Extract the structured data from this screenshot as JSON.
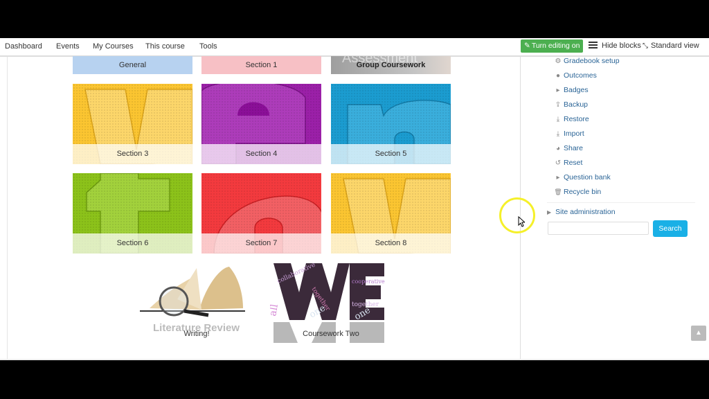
{
  "navbar": {
    "items": [
      "Dashboard",
      "Events",
      "My Courses",
      "This course",
      "Tools"
    ],
    "edit_button": "Turn editing on",
    "hide_blocks": "Hide blocks",
    "standard_view": "Standard view"
  },
  "sections": {
    "top_row": [
      {
        "label": "General",
        "color": "#a9c8ec",
        "caption_bg": "#b7d2f0"
      },
      {
        "label": "Section 1",
        "color": "#f7b7bd",
        "caption_bg": "#f7c0c5"
      },
      {
        "label": "Group Coursework",
        "color": "#b9b9b9",
        "caption_bg": "#c2c2c2",
        "overlay_text": "Assessment"
      }
    ],
    "tiles": [
      {
        "label": "Section 3",
        "color": "#fbc531",
        "letter": "v",
        "caption_bg": "rgba(255,255,255,0.72)"
      },
      {
        "label": "Section 4",
        "color": "#9b20a8",
        "letter": "e",
        "caption_bg": "rgba(255,255,255,0.72)"
      },
      {
        "label": "Section 5",
        "color": "#1b9cd0",
        "letter": "n",
        "caption_bg": "rgba(255,255,255,0.72)"
      },
      {
        "label": "Section 6",
        "color": "#8cc21a",
        "letter": "t",
        "caption_bg": "rgba(255,255,255,0.72)"
      },
      {
        "label": "Section 7",
        "color": "#f33a3e",
        "letter": "o",
        "caption_bg": "rgba(255,255,255,0.72)"
      },
      {
        "label": "Section 8",
        "color": "#fbc531",
        "letter": "v",
        "caption_bg": "rgba(255,255,255,0.72)"
      }
    ],
    "bottom_row": [
      {
        "label": "Writing!",
        "image_text": "Literature Review"
      },
      {
        "label": "Coursework Two",
        "image_text": "WE"
      }
    ]
  },
  "admin_block": {
    "items": [
      {
        "label": "Gradebook setup",
        "icon": "gear-icon",
        "glyph": "⚙"
      },
      {
        "label": "Outcomes",
        "icon": "outcomes-icon",
        "glyph": "●"
      },
      {
        "label": "Badges",
        "icon": "caret-right-icon",
        "glyph": "▸"
      },
      {
        "label": "Backup",
        "icon": "upload-icon",
        "glyph": "⇪"
      },
      {
        "label": "Restore",
        "icon": "download-icon",
        "glyph": "⤓"
      },
      {
        "label": "Import",
        "icon": "download-icon",
        "glyph": "⤓"
      },
      {
        "label": "Share",
        "icon": "globe-icon",
        "glyph": "◕"
      },
      {
        "label": "Reset",
        "icon": "reset-icon",
        "glyph": "↺"
      },
      {
        "label": "Question bank",
        "icon": "caret-right-icon",
        "glyph": "▸"
      },
      {
        "label": "Recycle bin",
        "icon": "trash-icon",
        "glyph": "🗑"
      }
    ],
    "site_admin": "Site administration",
    "search_placeholder": "",
    "search_button": "Search"
  }
}
